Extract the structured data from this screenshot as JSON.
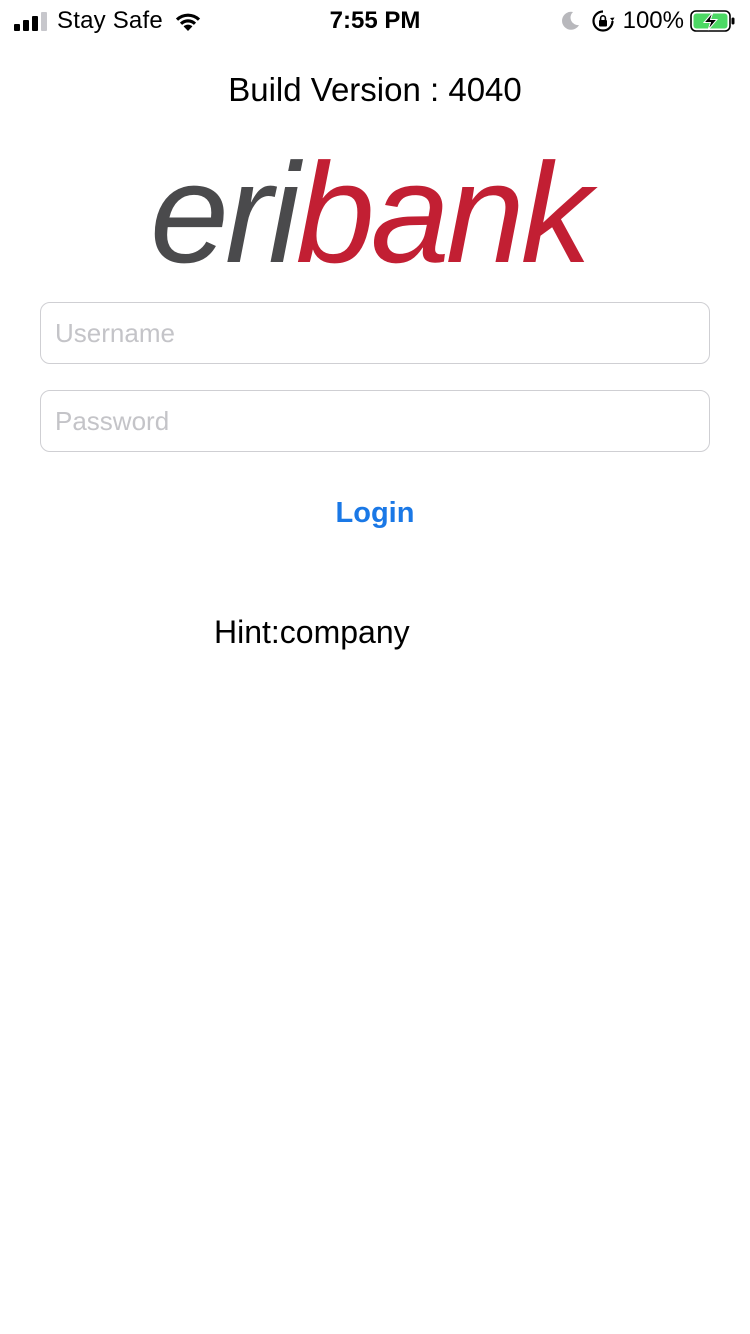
{
  "status_bar": {
    "carrier": "Stay Safe",
    "time": "7:55 PM",
    "battery_percent": "100%",
    "icons": [
      "signal-icon",
      "wifi-icon",
      "moon-icon",
      "orientation-lock-icon",
      "battery-charging-icon"
    ]
  },
  "header": {
    "build_version": "Build Version : 4040"
  },
  "logo": {
    "text_left": "eri",
    "text_right": "bank",
    "color_left": "#4a4a4c",
    "color_right": "#c21f33"
  },
  "form": {
    "username": {
      "value": "",
      "placeholder": "Username"
    },
    "password": {
      "value": "",
      "placeholder": "Password"
    },
    "login_label": "Login"
  },
  "hint": "Hint:company",
  "colors": {
    "accent": "#1a78e6",
    "brand_red": "#c21f33",
    "brand_gray": "#4a4a4c"
  }
}
